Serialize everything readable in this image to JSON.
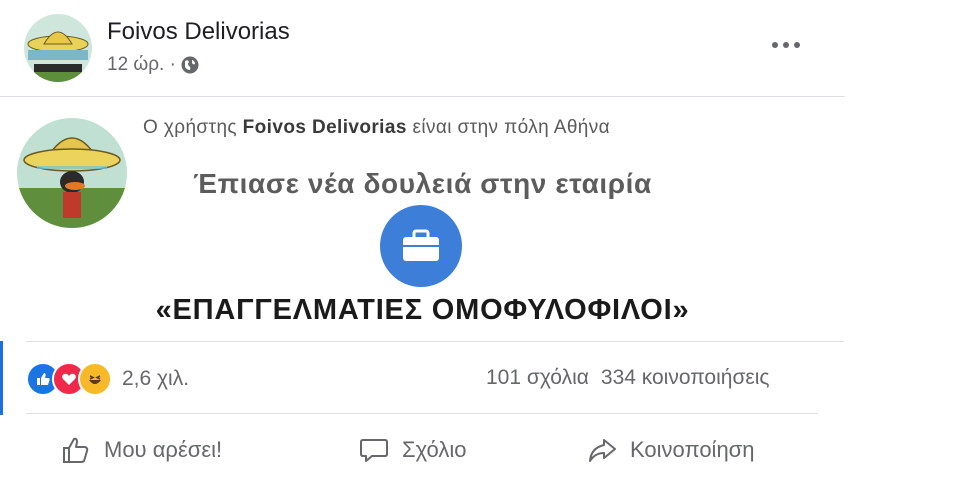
{
  "post": {
    "author": "Foivos Delivorias",
    "time": "12 ώρ. ·",
    "privacy_icon": "globe-icon",
    "more_icon": "more-options-icon"
  },
  "life_event": {
    "status_prefix": "Ο χρήστης",
    "status_name": "Foivos Delivorias",
    "status_suffix": "είναι στην πόλη Αθήνα",
    "headline": "Έπιασε νέα δουλειά στην εταιρία",
    "icon": "briefcase-icon",
    "company": "«ΕΠΑΓΓΕΛΜΑΤΙΕΣ ΟΜΟΦΥΛΟΦΙΛΟΙ»"
  },
  "stats": {
    "reaction_icons": [
      "like-reaction-icon",
      "love-reaction-icon",
      "haha-reaction-icon"
    ],
    "reactions_count": "2,6 χιλ.",
    "comments": "101 σχόλια",
    "shares": "334 κοινοποιήσεις"
  },
  "actions": {
    "like": "Μου αρέσει!",
    "comment": "Σχόλιο",
    "share": "Κοινοποίηση"
  },
  "colors": {
    "accent": "#1b74e4",
    "briefcase_bg": "#3d7ed9",
    "love": "#f0284a",
    "haha": "#f7b928",
    "text_secondary": "#65676b"
  }
}
